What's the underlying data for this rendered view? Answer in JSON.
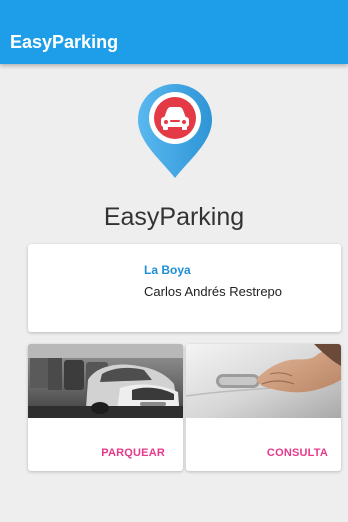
{
  "appbar": {
    "title": "EasyParking"
  },
  "header": {
    "app_name": "EasyParking",
    "logo_icon": "car-location-pin-icon"
  },
  "info_card": {
    "place": "La Boya",
    "user_name": "Carlos Andrés Restrepo"
  },
  "actions": [
    {
      "label": "PARQUEAR",
      "image": "parked-cars-photo"
    },
    {
      "label": "CONSULTA",
      "image": "car-door-handle-photo"
    }
  ],
  "colors": {
    "primary": "#1e9ee8",
    "accent": "#e5398a",
    "place_text": "#1e8fd6",
    "pin_blue": "#3aa3e0",
    "pin_red": "#e33a46"
  }
}
